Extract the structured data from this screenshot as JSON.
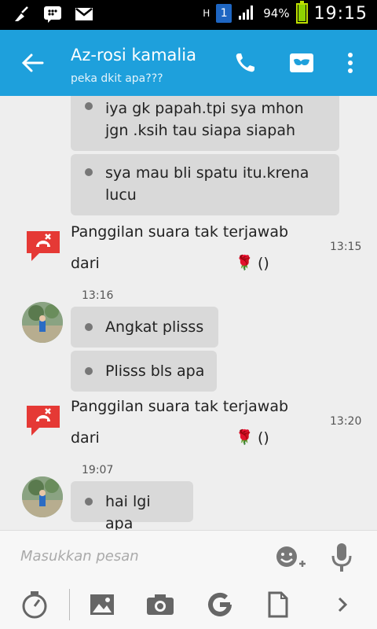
{
  "status_bar": {
    "network": "H",
    "sim": "1",
    "battery": "94%",
    "battery_level": 0.94,
    "time": "19:15"
  },
  "app_bar": {
    "title": "Az-rosi kamalia",
    "subtitle": "peka dkit apa???",
    "icons": [
      "back-arrow-icon",
      "phone-icon",
      "mask-icon",
      "more-vert-icon"
    ]
  },
  "messages": [
    {
      "text_line1": "iya gk papah.tpi sya mhon",
      "text_line2": "jgn .ksih tau siapa siapah"
    },
    {
      "text_line1": "sya mau bli spatu itu.krena",
      "text_line2": "lucu"
    }
  ],
  "missed_call_1": {
    "line1": "Panggilan suara tak terjawab",
    "line2": "dari",
    "suffix": "()",
    "time": "13:15"
  },
  "group_1": {
    "time": "13:16",
    "messages": [
      "Angkat plisss",
      "Plisss bls apa"
    ]
  },
  "missed_call_2": {
    "line1": "Panggilan suara tak terjawab",
    "line2": "dari",
    "suffix": "()",
    "time": "13:20"
  },
  "group_2": {
    "time": "19:07",
    "messages": [
      "hai lgi apa"
    ]
  },
  "input": {
    "placeholder": "Masukkan pesan"
  },
  "toolbar": {
    "icons": [
      "timer-icon",
      "image-icon",
      "camera-icon",
      "google-icon",
      "file-icon",
      "chevron-right-icon"
    ]
  },
  "colors": {
    "app_bar": "#1ea0dc",
    "bubble": "#d9d9d9",
    "missed_call": "#e53935"
  }
}
